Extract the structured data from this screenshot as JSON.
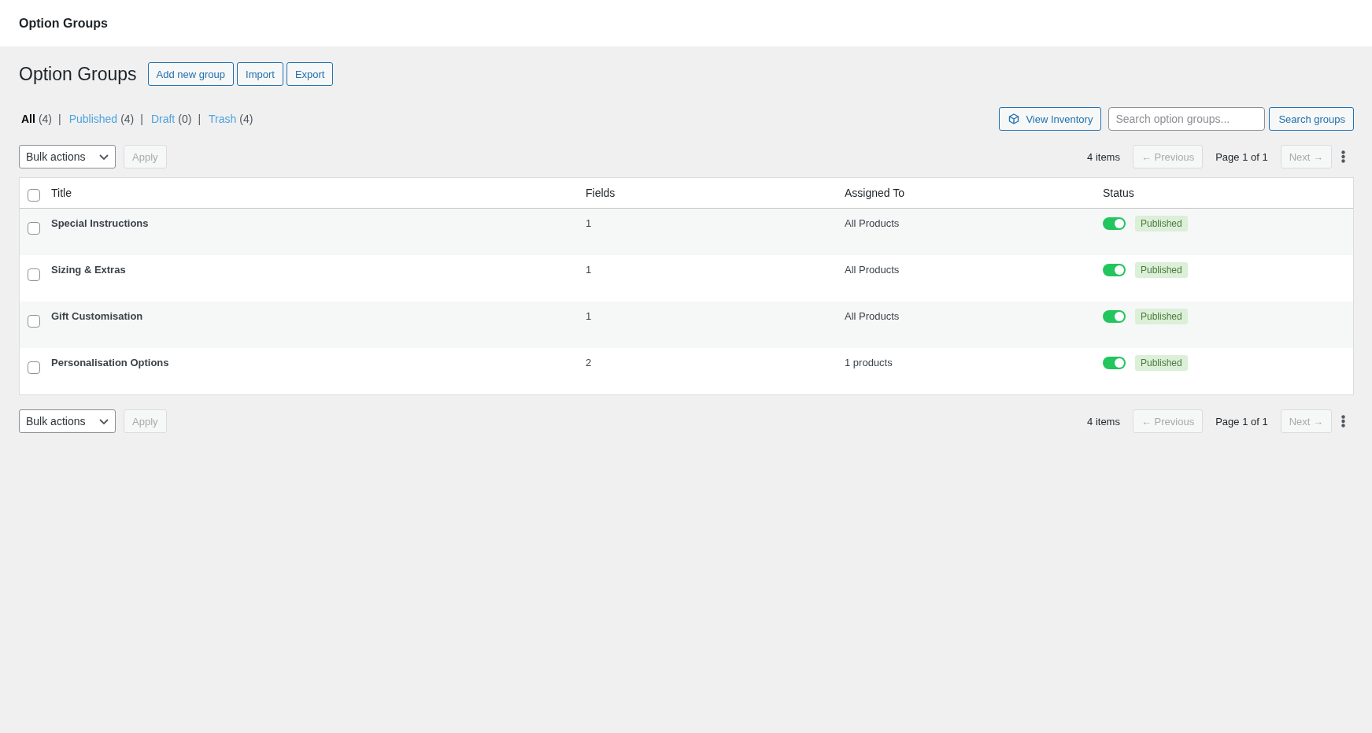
{
  "top_bar": {
    "title": "Option Groups"
  },
  "header": {
    "heading": "Option Groups",
    "actions": [
      "Add new group",
      "Import",
      "Export"
    ]
  },
  "filters": [
    {
      "label": "All",
      "count": "(4)",
      "separator": "|",
      "selected": true
    },
    {
      "label": "Published",
      "count": "(4)",
      "separator": "|",
      "selected": false
    },
    {
      "label": "Draft",
      "count": "(0)",
      "separator": "|",
      "selected": false
    },
    {
      "label": "Trash",
      "count": "(4)",
      "selected": false
    }
  ],
  "view_inventory_button": "View Inventory",
  "search": {
    "placeholder": "Search option groups...",
    "button": "Search groups"
  },
  "top_toolbar": {
    "bulk_actions": "Bulk actions",
    "apply": {
      "label": "Apply",
      "disabled": true
    },
    "item_count": "4 items",
    "previous": {
      "label": "← Previous",
      "disabled": true
    },
    "page": "Page 1 of 1",
    "next": {
      "label": "Next →",
      "disabled": true
    }
  },
  "table": {
    "select_all": {
      "checked": false
    },
    "columns": [
      "Title",
      "Fields",
      "Assigned To",
      "Status"
    ],
    "rows": [
      {
        "checked": false,
        "title": "Special Instructions",
        "fields": "1",
        "assigned_to": "All Products",
        "on": true,
        "status": "Published"
      },
      {
        "checked": false,
        "title": "Sizing & Extras",
        "fields": "1",
        "assigned_to": "All Products",
        "on": true,
        "status": "Published"
      },
      {
        "checked": false,
        "title": "Gift Customisation",
        "fields": "1",
        "assigned_to": "All Products",
        "on": true,
        "status": "Published"
      },
      {
        "checked": false,
        "title": "Personalisation Options",
        "fields": "2",
        "assigned_to": "1 products",
        "on": true,
        "status": "Published"
      }
    ]
  },
  "bottom_toolbar": {
    "bulk_actions": "Bulk actions",
    "apply": {
      "label": "Apply",
      "disabled": true
    },
    "item_count": "4 items",
    "previous": {
      "label": "← Previous",
      "disabled": true
    },
    "page": "Page 1 of 1",
    "next": {
      "label": "Next →",
      "disabled": true
    }
  }
}
